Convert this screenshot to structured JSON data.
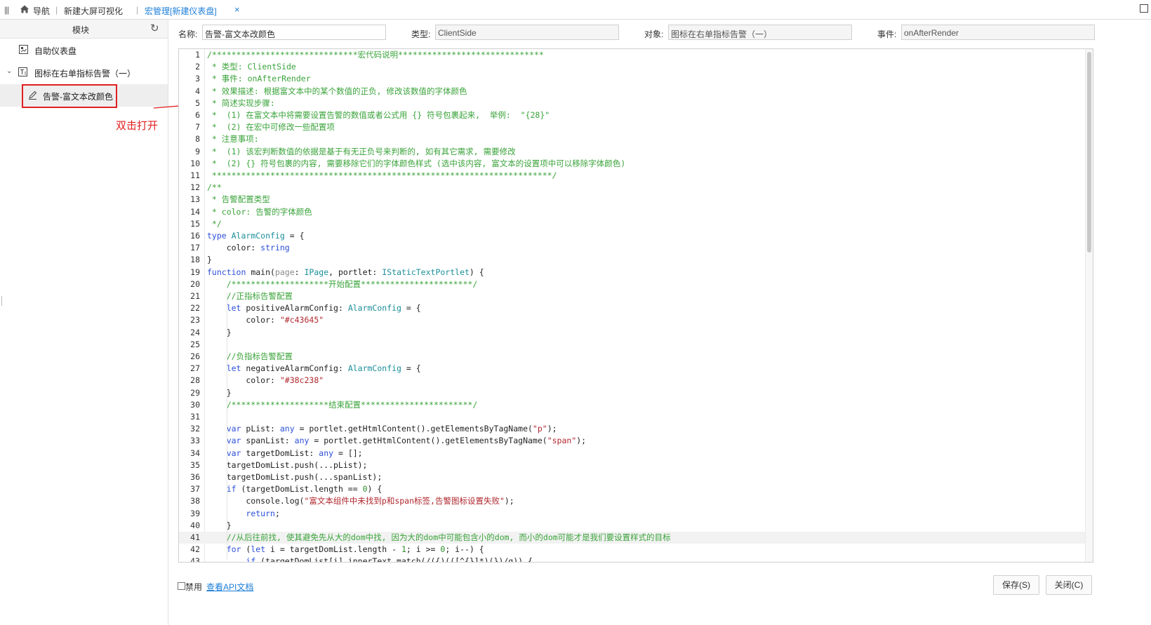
{
  "topbar": {
    "nav_label": "导航",
    "tab1": "新建大屏可视化",
    "active_tab": "宏管理[新建仪表盘]",
    "close_glyph": "×"
  },
  "sidebar": {
    "title": "模块",
    "items": [
      {
        "label": "自助仪表盘"
      },
      {
        "label": "图标在右单指标告警（一）"
      },
      {
        "label": "告警-富文本改颜色"
      }
    ],
    "annotation": "双击打开"
  },
  "form": {
    "name_label": "名称:",
    "name_value": "告警-富文本改颜色",
    "type_label": "类型:",
    "type_value": "ClientSide",
    "object_label": "对象:",
    "object_value": "图标在右单指标告警（一）",
    "event_label": "事件:",
    "event_value": "onAfterRender"
  },
  "footer": {
    "disable_label": "禁用",
    "api_link": "查看API文档",
    "save_label": "保存(S)",
    "close_label": "关闭(C)"
  },
  "code": {
    "lines": [
      [
        [
          "/******************************宏代码说明******************************",
          "cm"
        ]
      ],
      [
        [
          " * 类型: ClientSide",
          "cm"
        ]
      ],
      [
        [
          " * 事件: onAfterRender",
          "cm"
        ]
      ],
      [
        [
          " * 效果描述: 根据富文本中的某个数值的正负, 修改该数值的字体颜色",
          "cm"
        ]
      ],
      [
        [
          " * 简述实现步骤:",
          "cm"
        ]
      ],
      [
        [
          " *  (1) 在富文本中将需要设置告警的数值或者公式用 {} 符号包裹起来,  举例:  \"{28}\"",
          "cm"
        ]
      ],
      [
        [
          " *  (2) 在宏中可修改一些配置项",
          "cm"
        ]
      ],
      [
        [
          " * 注意事项:",
          "cm"
        ]
      ],
      [
        [
          " *  (1) 该宏判断数值的依据是基于有无正负号来判断的, 如有其它需求, 需要修改",
          "cm"
        ]
      ],
      [
        [
          " *  (2) {} 符号包裹的内容, 需要移除它们的字体颜色样式 (选中该内容, 富文本的设置项中可以移除字体颜色)",
          "cm"
        ]
      ],
      [
        [
          " **********************************************************************/",
          "cm"
        ]
      ],
      [
        [
          "/**",
          "cm"
        ]
      ],
      [
        [
          " * 告警配置类型",
          "cm"
        ]
      ],
      [
        [
          " * color: 告警的字体颜色",
          "cm"
        ]
      ],
      [
        [
          " */",
          "cm"
        ]
      ],
      [
        [
          "type ",
          "kw"
        ],
        [
          "AlarmConfig",
          "ty"
        ],
        [
          " = {",
          "df"
        ]
      ],
      [
        [
          "    color: ",
          "df"
        ],
        [
          "string",
          "kw"
        ]
      ],
      [
        [
          "}",
          "df"
        ]
      ],
      [
        [
          "function ",
          "kw"
        ],
        [
          "main(",
          "df"
        ],
        [
          "page",
          "pa"
        ],
        [
          ": ",
          "df"
        ],
        [
          "IPage",
          "ty"
        ],
        [
          ", portlet: ",
          "df"
        ],
        [
          "IStaticTextPortlet",
          "ty"
        ],
        [
          ") {",
          "df"
        ]
      ],
      [
        [
          "    /********************开始配置***********************/",
          "cm"
        ]
      ],
      [
        [
          "    //正指标告警配置",
          "cm"
        ]
      ],
      [
        [
          "    ",
          "df"
        ],
        [
          "let ",
          "kw"
        ],
        [
          "positiveAlarmConfig: ",
          "df"
        ],
        [
          "AlarmConfig",
          "ty"
        ],
        [
          " = {",
          "df"
        ]
      ],
      [
        [
          "        color: ",
          "df"
        ],
        [
          "\"#c43645\"",
          "st"
        ]
      ],
      [
        [
          "    }",
          "df"
        ]
      ],
      [
        [
          "",
          "df"
        ]
      ],
      [
        [
          "    //负指标告警配置",
          "cm"
        ]
      ],
      [
        [
          "    ",
          "df"
        ],
        [
          "let ",
          "kw"
        ],
        [
          "negativeAlarmConfig: ",
          "df"
        ],
        [
          "AlarmConfig",
          "ty"
        ],
        [
          " = {",
          "df"
        ]
      ],
      [
        [
          "        color: ",
          "df"
        ],
        [
          "\"#38c238\"",
          "st"
        ]
      ],
      [
        [
          "    }",
          "df"
        ]
      ],
      [
        [
          "    /********************结束配置***********************/",
          "cm"
        ]
      ],
      [
        [
          "",
          "df"
        ]
      ],
      [
        [
          "    ",
          "df"
        ],
        [
          "var ",
          "kw"
        ],
        [
          "pList: ",
          "df"
        ],
        [
          "any",
          "kw"
        ],
        [
          " = portlet.getHtmlContent().getElementsByTagName(",
          "df"
        ],
        [
          "\"p\"",
          "st"
        ],
        [
          ");",
          "df"
        ]
      ],
      [
        [
          "    ",
          "df"
        ],
        [
          "var ",
          "kw"
        ],
        [
          "spanList: ",
          "df"
        ],
        [
          "any",
          "kw"
        ],
        [
          " = portlet.getHtmlContent().getElementsByTagName(",
          "df"
        ],
        [
          "\"span\"",
          "st"
        ],
        [
          ");",
          "df"
        ]
      ],
      [
        [
          "    ",
          "df"
        ],
        [
          "var ",
          "kw"
        ],
        [
          "targetDomList: ",
          "df"
        ],
        [
          "any",
          "kw"
        ],
        [
          " = [];",
          "df"
        ]
      ],
      [
        [
          "    targetDomList.push(...pList);",
          "df"
        ]
      ],
      [
        [
          "    targetDomList.push(...spanList);",
          "df"
        ]
      ],
      [
        [
          "    ",
          "df"
        ],
        [
          "if ",
          "kw"
        ],
        [
          "(targetDomList.length == ",
          "df"
        ],
        [
          "0",
          "nu"
        ],
        [
          ") {",
          "df"
        ]
      ],
      [
        [
          "        console.log(",
          "df"
        ],
        [
          "\"富文本组件中未找到p和span标签,告警图标设置失败\"",
          "st"
        ],
        [
          ");",
          "df"
        ]
      ],
      [
        [
          "        ",
          "df"
        ],
        [
          "return",
          "kw"
        ],
        [
          ";",
          "df"
        ]
      ],
      [
        [
          "    }",
          "df"
        ]
      ],
      [
        [
          "    //从后往前找, 使其避免先从大的dom中找, 因为大的dom中可能包含小的dom, 而小的dom可能才是我们要设置样式的目标",
          "cm"
        ]
      ],
      [
        [
          "    ",
          "df"
        ],
        [
          "for ",
          "kw"
        ],
        [
          "(",
          "df"
        ],
        [
          "let ",
          "kw"
        ],
        [
          "i = targetDomList.length - ",
          "df"
        ],
        [
          "1",
          "nu"
        ],
        [
          "; i >= ",
          "df"
        ],
        [
          "0",
          "nu"
        ],
        [
          "; i--) {",
          "df"
        ]
      ],
      [
        [
          "        ",
          "df"
        ],
        [
          "if ",
          "kw"
        ],
        [
          "(targetDomList[i].innerText.match(/({)(([^{}]*)(})/g)) {",
          "df"
        ]
      ]
    ]
  }
}
